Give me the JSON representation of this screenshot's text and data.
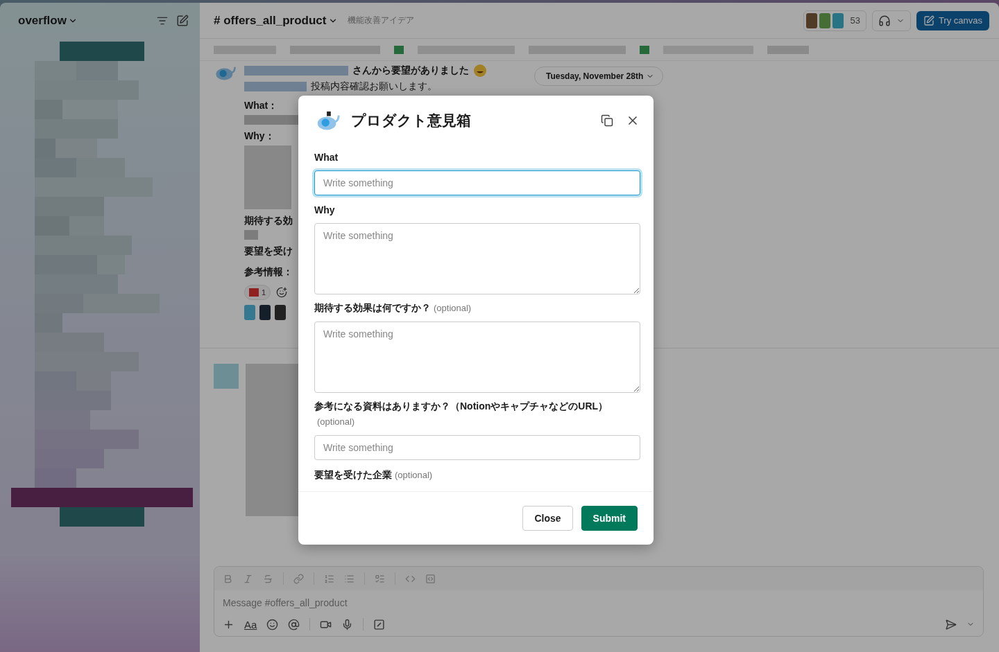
{
  "sidebar": {
    "workspace": "overflow"
  },
  "channel": {
    "name": "# offers_all_product",
    "topic": "機能改善アイデア",
    "member_count": "53",
    "canvas_button": "Try canvas"
  },
  "date_divider": "Tuesday, November 28th",
  "message": {
    "headline": "さんから要望がありました",
    "subline": "投稿内容確認お願いします。",
    "fields": [
      "What：",
      "Why：",
      "期待する効",
      "要望を受け",
      "参考情報："
    ],
    "reaction_count": "1"
  },
  "composer": {
    "placeholder": "Message #offers_all_product",
    "format_button": "Aa"
  },
  "modal": {
    "title": "プロダクト意見箱",
    "fields": [
      {
        "label": "What",
        "kind": "input",
        "placeholder": "Write something",
        "focused": true
      },
      {
        "label": "Why",
        "kind": "textarea",
        "placeholder": "Write something",
        "focused": false
      },
      {
        "label": "期待する効果は何ですか？",
        "optional": "(optional)",
        "kind": "textarea",
        "placeholder": "Write something",
        "focused": false
      },
      {
        "label": "参考になる資料はありますか？（NotionやキャプチャなどのURL）",
        "optional": "(optional)",
        "kind": "input",
        "placeholder": "Write something",
        "focused": false
      },
      {
        "label": "要望を受けた企業",
        "optional": "(optional)",
        "kind": "label"
      }
    ],
    "buttons": [
      {
        "label": "Close",
        "kind": "secondary"
      },
      {
        "label": "Submit",
        "kind": "primary"
      }
    ]
  }
}
